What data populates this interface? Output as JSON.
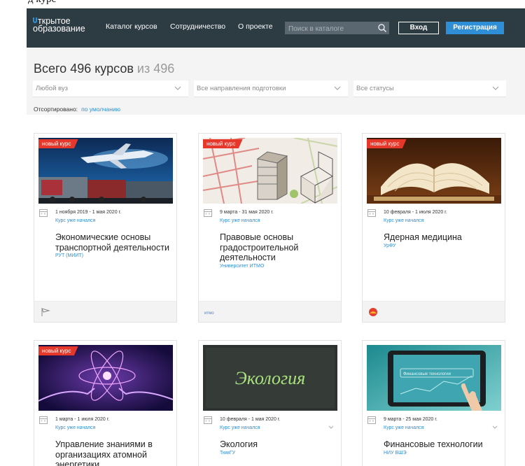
{
  "top_fragment": "д           курс",
  "header": {
    "logo_line1": "ткрытое",
    "logo_line2": "образование",
    "nav": [
      "Каталог курсов",
      "Сотрудничество",
      "О проекте"
    ],
    "search_placeholder": "Поиск в каталоге",
    "login": "Вход",
    "register": "Регистрация"
  },
  "catalog": {
    "heading": "Всего 496 курсов",
    "heading_of": "из 496",
    "filters": [
      "Любой вуз",
      "Все направления подготовки",
      "Все статусы"
    ],
    "sorted_label": "Отсортировано:",
    "sorted_value": "по умолчанию"
  },
  "courses": [
    {
      "badge": "новый курс",
      "date": "1 ноября 2019 - 1 мая 2020 г.",
      "status": "Курс уже начался",
      "title": "Экономические основы транспортной деятельности",
      "university": "РУТ (МИИТ)",
      "image": "transport-image",
      "foot": "rut-logo"
    },
    {
      "badge": "новый курс",
      "date": "9 марта - 31 мая 2020 г.",
      "status": "Курс уже начался",
      "title": "Правовые основы градостроительной деятельности",
      "university": "Университет ИТМО",
      "image": "city-planning-image",
      "foot": "itmo-logo"
    },
    {
      "badge": "новый курс",
      "date": "10 февраля - 1 июля 2020 г.",
      "status": "Курс уже начался",
      "title": "Ядерная медицина",
      "university": "УрФУ",
      "image": "books-image",
      "foot": "urfu-logo"
    },
    {
      "badge": "новый курс",
      "date": "1 марта - 1 июля 2020 г.",
      "status": "Курс уже начался",
      "title": "Управление знаниями в организациях атомной энергетики",
      "university": "",
      "image": "atom-image",
      "foot": ""
    },
    {
      "badge": "",
      "date": "10 февраля - 1 мая 2020 г.",
      "status": "Курс уже начался",
      "title": "Экология",
      "university": "ТюмГУ",
      "image": "ecology-image",
      "image_text": "Экология",
      "foot": ""
    },
    {
      "badge": "",
      "date": "9 марта - 25 мая 2020 г.",
      "status": "Курс уже начался",
      "title": "Финансовые технологии",
      "university": "НИУ ВШЭ",
      "image": "fintech-image",
      "image_text": "Финансовые технологии",
      "foot": ""
    }
  ],
  "colors": {
    "navbar": "#2d3b43",
    "accent": "#2f8fd6",
    "badge": "#e5372a",
    "filters_bg": "#f4f4f4"
  }
}
